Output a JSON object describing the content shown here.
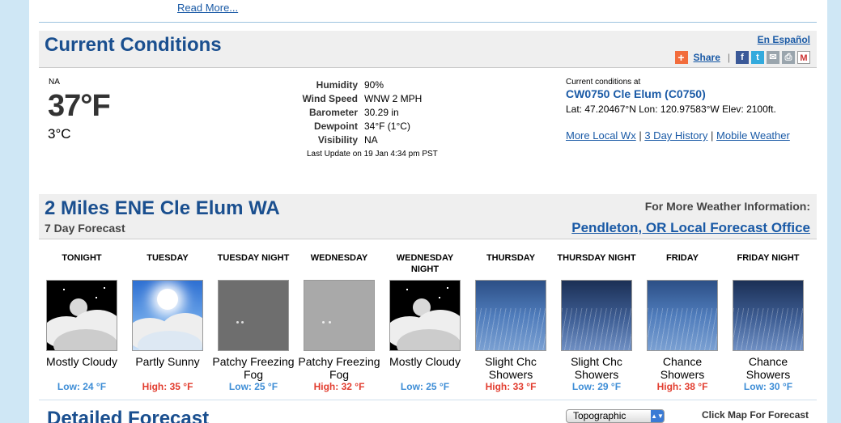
{
  "read_more": "Read More...",
  "current": {
    "title": "Current Conditions",
    "espanol": "En Español",
    "share_label": "Share",
    "share_sep": "|",
    "condition": "NA",
    "temp_f": "37°F",
    "temp_c": "3°C",
    "details": [
      {
        "label": "Humidity",
        "value": "90%"
      },
      {
        "label": "Wind Speed",
        "value": "WNW 2 MPH"
      },
      {
        "label": "Barometer",
        "value": "30.29 in"
      },
      {
        "label": "Dewpoint",
        "value": "34°F (1°C)"
      },
      {
        "label": "Visibility",
        "value": "NA"
      }
    ],
    "last_update": "Last Update on 19 Jan 4:34 pm PST",
    "at_label": "Current conditions at",
    "station": "CW0750 Cle Elum (C0750)",
    "latlon": "Lat: 47.20467°N Lon: 120.97583°W Elev: 2100ft.",
    "links": {
      "more_local": "More Local Wx",
      "history": "3 Day History",
      "mobile": "Mobile Weather",
      "sep": "|"
    }
  },
  "forecast": {
    "title": "2 Miles ENE Cle Elum WA",
    "subtitle": "7 Day Forecast",
    "more_info": "For More Weather Information:",
    "office": "Pendleton, OR Local Forecast Office",
    "periods": [
      {
        "name": "TONIGHT",
        "desc": "Mostly Cloudy",
        "temp": "Low: 24 °F",
        "kind": "low",
        "icon": "night-mostly-cloudy-icon"
      },
      {
        "name": "TUESDAY",
        "desc": "Partly Sunny",
        "temp": "High: 35 °F",
        "kind": "high",
        "icon": "partly-sunny-icon"
      },
      {
        "name": "TUESDAY NIGHT",
        "desc": "Patchy Freezing Fog",
        "temp": "Low: 25 °F",
        "kind": "low",
        "icon": "night-freezing-fog-icon"
      },
      {
        "name": "WEDNESDAY",
        "desc": "Patchy Freezing Fog",
        "temp": "High: 32 °F",
        "kind": "high",
        "icon": "freezing-fog-icon"
      },
      {
        "name": "WEDNESDAY NIGHT",
        "desc": "Mostly Cloudy",
        "temp": "Low: 25 °F",
        "kind": "low",
        "icon": "night-mostly-cloudy-icon"
      },
      {
        "name": "THURSDAY",
        "desc": "Slight Chc Showers",
        "temp": "High: 33 °F",
        "kind": "high",
        "icon": "showers-icon"
      },
      {
        "name": "THURSDAY NIGHT",
        "desc": "Slight Chc Showers",
        "temp": "Low: 29 °F",
        "kind": "low",
        "icon": "night-showers-icon"
      },
      {
        "name": "FRIDAY",
        "desc": "Chance Showers",
        "temp": "High: 38 °F",
        "kind": "high",
        "icon": "showers-icon"
      },
      {
        "name": "FRIDAY NIGHT",
        "desc": "Chance Showers",
        "temp": "Low: 30 °F",
        "kind": "low",
        "icon": "night-showers-icon"
      }
    ]
  },
  "detailed": {
    "title": "Detailed Forecast",
    "map_type": "Topographic",
    "click_map": "Click Map For Forecast"
  },
  "colors": {
    "title_blue": "#1a4f8f",
    "link_blue": "#1a5aa6",
    "low_temp": "#3d8dd6",
    "high_temp": "#e23d2f",
    "page_bg": "#cfe7f5"
  }
}
